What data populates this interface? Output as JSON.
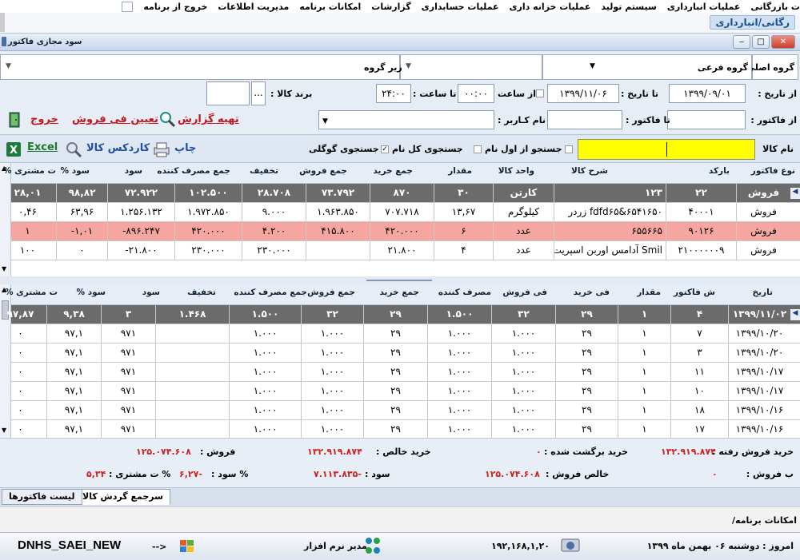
{
  "menubar": {
    "items": [
      "ت بازرگانی",
      "عملیات انبارداری",
      "سیستم تولید",
      "عملیات خزانه داری",
      "عملیات حسابداری",
      "گزارشات",
      "امکانات برنامه",
      "مدیریت اطلاعات",
      "خروج از برنامه"
    ]
  },
  "strip": {
    "subtitle": "رگانی/انبارداری"
  },
  "window": {
    "title": "سود مجازی فاکتور",
    "min": "‒",
    "max": "□",
    "close": "✕"
  },
  "filters": {
    "main_group_label": "گروه اصلی",
    "sub_group_label": "گروه فرعی",
    "sub_sub_group_label": "زیر گروه",
    "from_date_label": "از تاریخ :",
    "from_date": "۱۳۹۹/۰۹/۰۱",
    "to_date_label": "تا تاریخ :",
    "to_date": "۱۳۹۹/۱۱/۰۶",
    "from_time_label": "از ساعت",
    "from_time": "۰۰:۰۰",
    "to_time_label": "تا ساعت :",
    "to_time": "۲۴:۰۰",
    "brand_label": "برند کالا :",
    "brand_button": "...",
    "from_invoice_label": "از فاکتور :",
    "to_invoice_label": "تا فاکتور :",
    "username_label": "نام کـاربر :"
  },
  "actions": {
    "prepare_report": "تهیه گزارش",
    "set_price": "تعیین فی فروش",
    "exit": "خروج",
    "print": "چاپ",
    "card_index": "کاردکس کالا",
    "excel": "Excel"
  },
  "search": {
    "item_name_label": "نام کالا",
    "item_name_value": "",
    "from_start_label": "جستجو از اول نام",
    "full_name_label": "جستجوی کل نام",
    "google_label": "جستجوی گوگلی"
  },
  "grid1": {
    "headers": [
      "نوع فاکتور",
      "بارکد",
      "شرح کالا",
      "واحد کالا",
      "مقدار",
      "جمع خرید",
      "جمع فروش",
      "تخفیف",
      "جمع مصرف کننده",
      "سود",
      "% سود",
      "% ت مشتری"
    ],
    "rows": [
      {
        "style": "dark",
        "cells": [
          "فروش",
          "۲۲",
          "۱۲۳",
          "کارتن",
          "۳۰",
          "۸۷۰",
          "۷۳.۷۹۲",
          "۲۸.۷۰۸",
          "۱۰۲.۵۰۰",
          "۷۲.۹۲۲",
          "۹۸,۸۲",
          "۲۸,۰۱"
        ]
      },
      {
        "style": "white",
        "cells": [
          "فروش",
          "۴۰۰۰۱",
          "fdfd۶۵&۶۵۴۱۶۵۰ زردر",
          "کیلوگرم",
          "۱۳,۶۷",
          "۷۰۷.۷۱۸",
          "۱.۹۶۳.۸۵۰",
          "۹.۰۰۰",
          "۱.۹۷۲.۸۵۰",
          "۱.۲۵۶.۱۳۲",
          "۶۳,۹۶",
          "۰,۴۶"
        ]
      },
      {
        "style": "pink",
        "cells": [
          "فروش",
          "۹۰۱۲۶",
          "۶۵۵۶۶۵",
          "عدد",
          "۶",
          "۴۲۰.۰۰۰",
          "۴۱۵.۸۰۰",
          "۴.۲۰۰",
          "۴۲۰.۰۰۰",
          "-۸۹۶.۲۴۷",
          "-۱,۰۱",
          "۱"
        ]
      },
      {
        "style": "white",
        "cells": [
          "فروش",
          "۲۱۰۰۰۰۰۰۹",
          "Smil آدامس اوربن اسپریت",
          "عدد",
          "۴",
          "۲۱.۸۰۰",
          "",
          "۲۳۰.۰۰۰",
          "۲۳۰.۰۰۰",
          "-۲۱.۸۰۰",
          "۰",
          "۱۰۰"
        ]
      }
    ]
  },
  "grid2": {
    "headers": [
      "تاریخ",
      "ش فاکتور",
      "مقدار",
      "فی خرید",
      "فی فروش",
      "مصرف کننده",
      "جمع خرید",
      "جمع فروش",
      "جمع مصرف کننده",
      "تخفیف",
      "سود",
      "% سود",
      "% ت مشتری"
    ],
    "rows": [
      {
        "style": "dark",
        "cells": [
          "۱۳۹۹/۱۱/۰۲",
          "۴",
          "۱",
          "۲۹",
          "۳۲",
          "۱.۵۰۰",
          "۲۹",
          "۳۲",
          "۱.۵۰۰",
          "۱.۴۶۸",
          "۳",
          "۹,۳۸",
          "۹۷,۸۷"
        ]
      },
      {
        "style": "white",
        "cells": [
          "۱۳۹۹/۱۰/۲۰",
          "۷",
          "۱",
          "۲۹",
          "۱.۰۰۰",
          "۱.۰۰۰",
          "۲۹",
          "۱.۰۰۰",
          "۱.۰۰۰",
          "",
          "۹۷۱",
          "۹۷,۱",
          "۰"
        ]
      },
      {
        "style": "white",
        "cells": [
          "۱۳۹۹/۱۰/۲۰",
          "۳",
          "۱",
          "۲۹",
          "۱.۰۰۰",
          "۱.۰۰۰",
          "۲۹",
          "۱.۰۰۰",
          "۱.۰۰۰",
          "",
          "۹۷۱",
          "۹۷,۱",
          "۰"
        ]
      },
      {
        "style": "white",
        "cells": [
          "۱۳۹۹/۱۰/۱۷",
          "۱۱",
          "۱",
          "۲۹",
          "۱.۰۰۰",
          "۱.۰۰۰",
          "۲۹",
          "۱.۰۰۰",
          "۱.۰۰۰",
          "",
          "۹۷۱",
          "۹۷,۱",
          "۰"
        ]
      },
      {
        "style": "white",
        "cells": [
          "۱۳۹۹/۱۰/۱۷",
          "۱۰",
          "۱",
          "۲۹",
          "۱.۰۰۰",
          "۱.۰۰۰",
          "۲۹",
          "۱.۰۰۰",
          "۱.۰۰۰",
          "",
          "۹۷۱",
          "۹۷,۱",
          "۰"
        ]
      },
      {
        "style": "white",
        "cells": [
          "۱۳۹۹/۱۰/۱۶",
          "۱۸",
          "۱",
          "۲۹",
          "۱.۰۰۰",
          "۱.۰۰۰",
          "۲۹",
          "۱.۰۰۰",
          "۱.۰۰۰",
          "",
          "۹۷۱",
          "۹۷,۱",
          "۰"
        ]
      },
      {
        "style": "white",
        "cells": [
          "۱۳۹۹/۱۰/۱۶",
          "۱۷",
          "۱",
          "۲۹",
          "۱.۰۰۰",
          "۱.۰۰۰",
          "۲۹",
          "۱.۰۰۰",
          "۱.۰۰۰",
          "",
          "۹۷۱",
          "۹۷,۱",
          "۰"
        ]
      }
    ]
  },
  "summary": {
    "sold_purchase_label": "خرید فروش رفته :",
    "sold_purchase_value": "۱۳۲.۹۱۹.۸۷۴",
    "returned_purchase_label": "خرید برگشت شده :",
    "returned_purchase_value": "۰",
    "net_purchase_label": "خرید خالص :",
    "net_purchase_value": "۱۳۲.۹۱۹.۸۷۴",
    "sales_label": "فروش :",
    "sales_value": "۱۲۵.۰۷۴.۶۰۸",
    "returned_sales_label": "ب فروش :",
    "returned_sales_value": "۰",
    "net_sales_label": "خالص فروش :",
    "net_sales_value": "۱۲۵.۰۷۴.۶۰۸",
    "profit_label": "سود :",
    "profit_value": "-۷.۱۱۳.۸۳۵",
    "profit_pct_label": "% سود :",
    "profit_pct_value": "-۶,۲۷",
    "customer_pct_label": "% ت مشتری :",
    "customer_pct_value": "۵,۳۴"
  },
  "tabs": [
    "سرجمع گردش کالا",
    "لیست فاکتورها"
  ],
  "gap_text": "امکانات برنامه/",
  "statusbar": {
    "date_text": "امروز : دوشنبه ۰۶ بهمن ماه ۱۳۹۹",
    "ip": "۱۹۲,۱۶۸,۱,۲۰",
    "user": "مدیر نرم افزار",
    "arrow": "-->",
    "host": "DNHS_SAEI_NEW"
  },
  "colors": {
    "dark_row": "#6b6b6b",
    "pink_row": "#f6a6a1",
    "action_red": "#c2171d",
    "search_yellow": "#ffff00"
  }
}
